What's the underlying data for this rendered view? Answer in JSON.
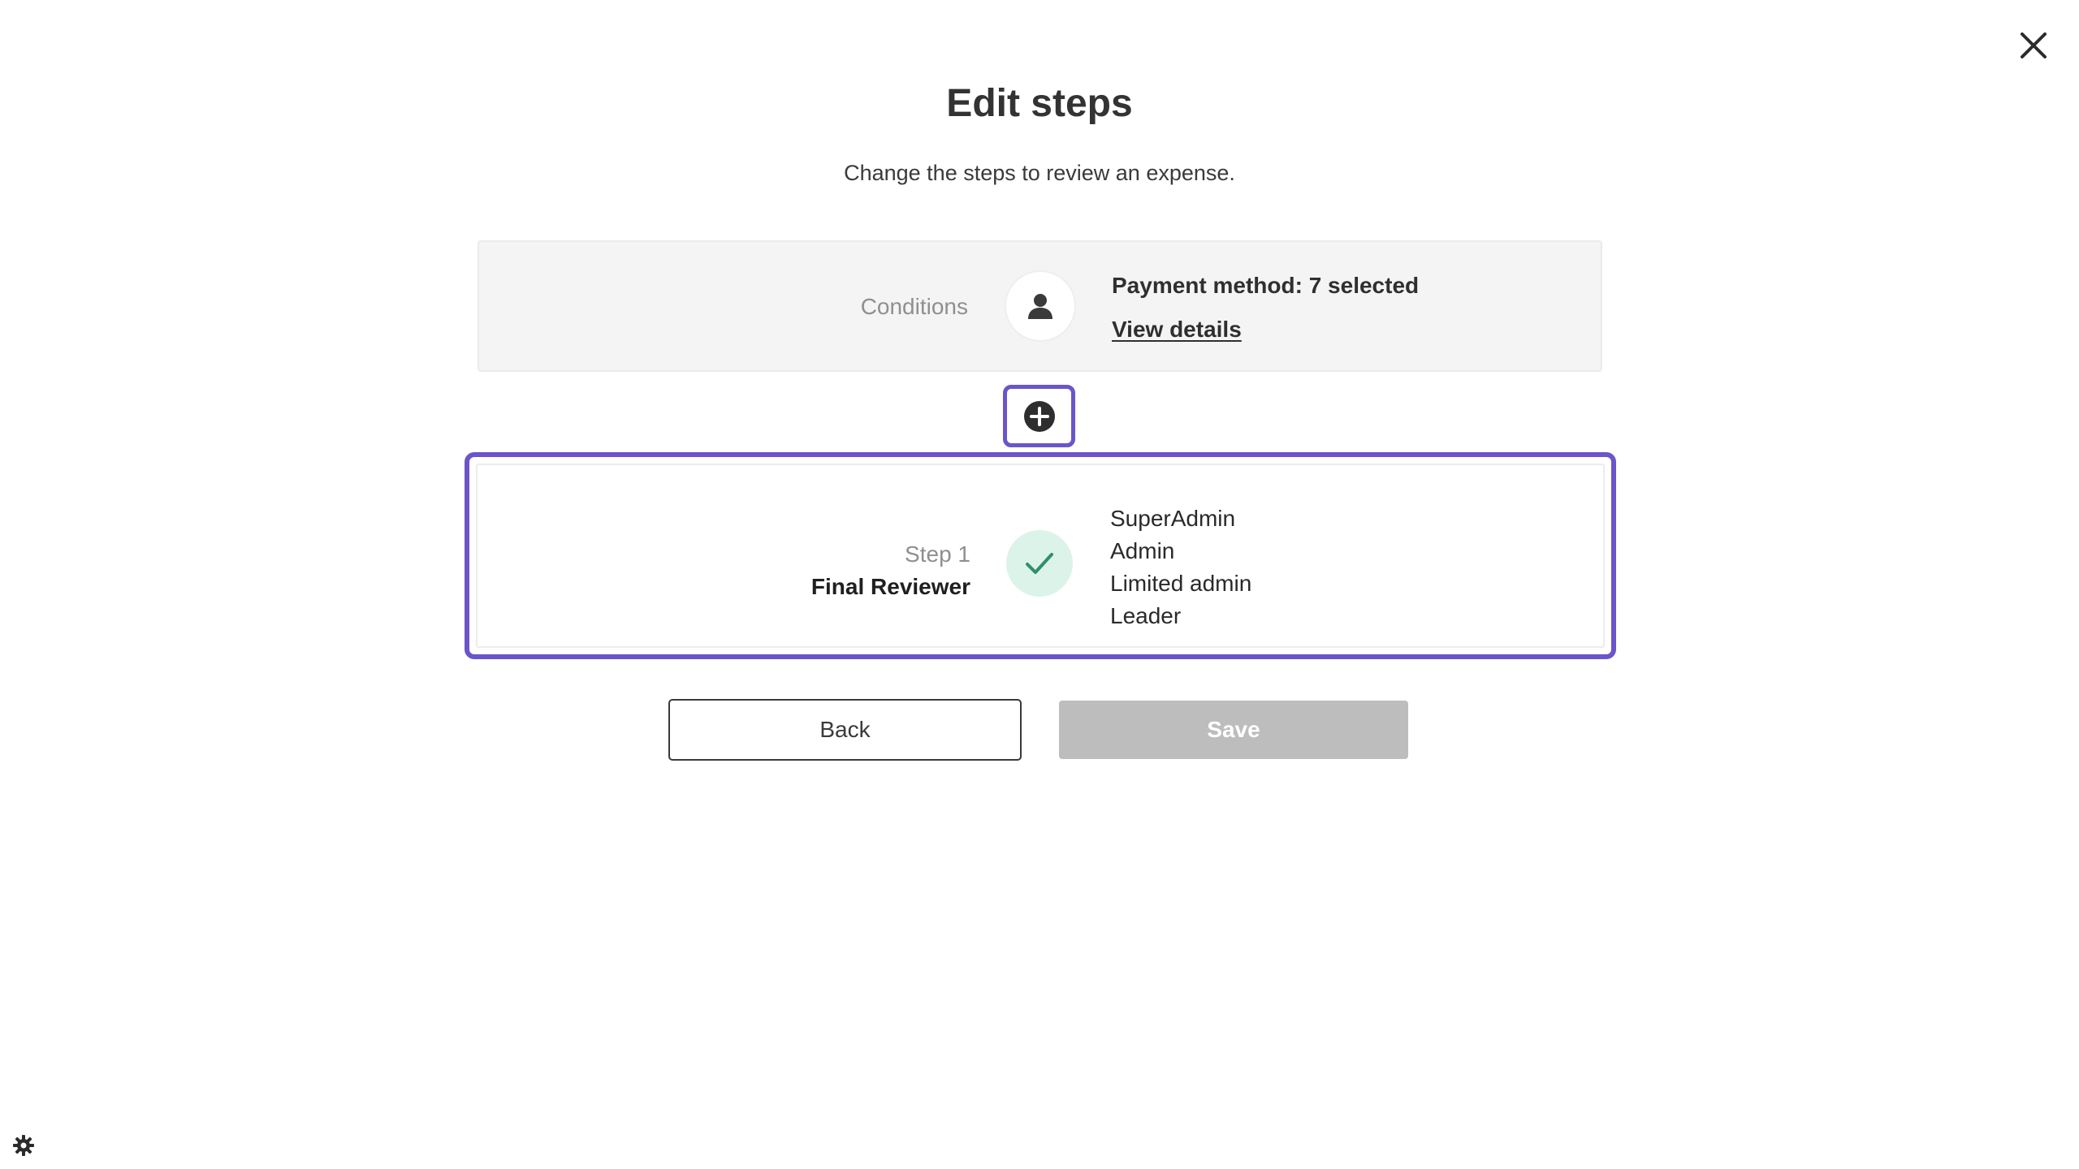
{
  "dialog": {
    "title": "Edit steps",
    "subtitle": "Change the steps to review an expense.",
    "close_icon": "close-icon"
  },
  "conditions": {
    "label": "Conditions",
    "icon": "person-icon",
    "summary": "Payment method: 7 selected",
    "link_text": "View details"
  },
  "add_step": {
    "icon": "plus-circle-icon",
    "accent_color": "#6b55c9"
  },
  "steps": [
    {
      "number_label": "Step 1",
      "name": "Final Reviewer",
      "icon": "check-icon",
      "roles": [
        "SuperAdmin",
        "Admin",
        "Limited admin",
        "Leader"
      ]
    }
  ],
  "actions": {
    "back_label": "Back",
    "save_label": "Save"
  },
  "settings": {
    "icon": "gear-icon"
  }
}
